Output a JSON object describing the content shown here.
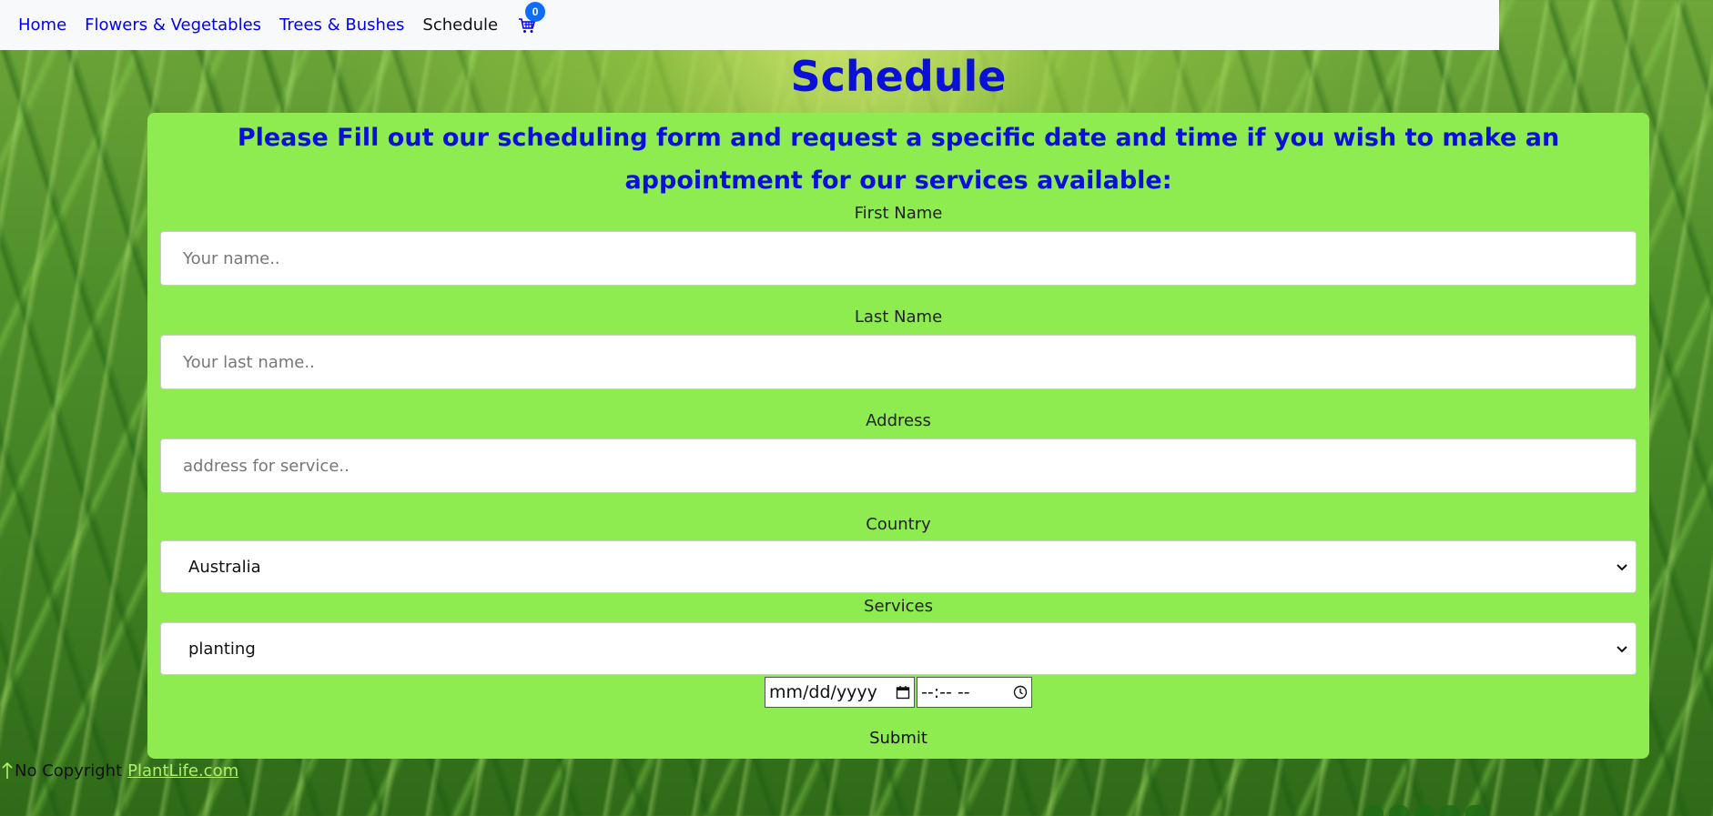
{
  "nav": {
    "items": [
      {
        "label": "Home"
      },
      {
        "label": "Flowers & Vegetables"
      },
      {
        "label": "Trees & Bushes"
      },
      {
        "label": "Schedule"
      }
    ],
    "cart_count": "0",
    "cart_icon": "shopping-cart-icon"
  },
  "page": {
    "title": "Schedule",
    "intro": "Please Fill out our scheduling form and request a specific date and time if you wish to make an appointment for our services available:"
  },
  "form": {
    "first_name": {
      "label": "First Name",
      "placeholder": "Your name.."
    },
    "last_name": {
      "label": "Last Name",
      "placeholder": "Your last name.."
    },
    "address": {
      "label": "Address",
      "placeholder": "address for service.."
    },
    "country": {
      "label": "Country",
      "value": "Australia"
    },
    "services": {
      "label": "Services",
      "value": "planting"
    },
    "date": {
      "placeholder": "mm/dd/yyyy"
    },
    "time": {
      "placeholder": "--:-- --"
    },
    "submit_label": "Submit"
  },
  "footer": {
    "text": "No Copyright",
    "link": "PlantLife.com"
  },
  "colors": {
    "accent_blue": "#0b10d8",
    "form_green": "#8eec50",
    "badge_blue": "#0d6efd"
  }
}
